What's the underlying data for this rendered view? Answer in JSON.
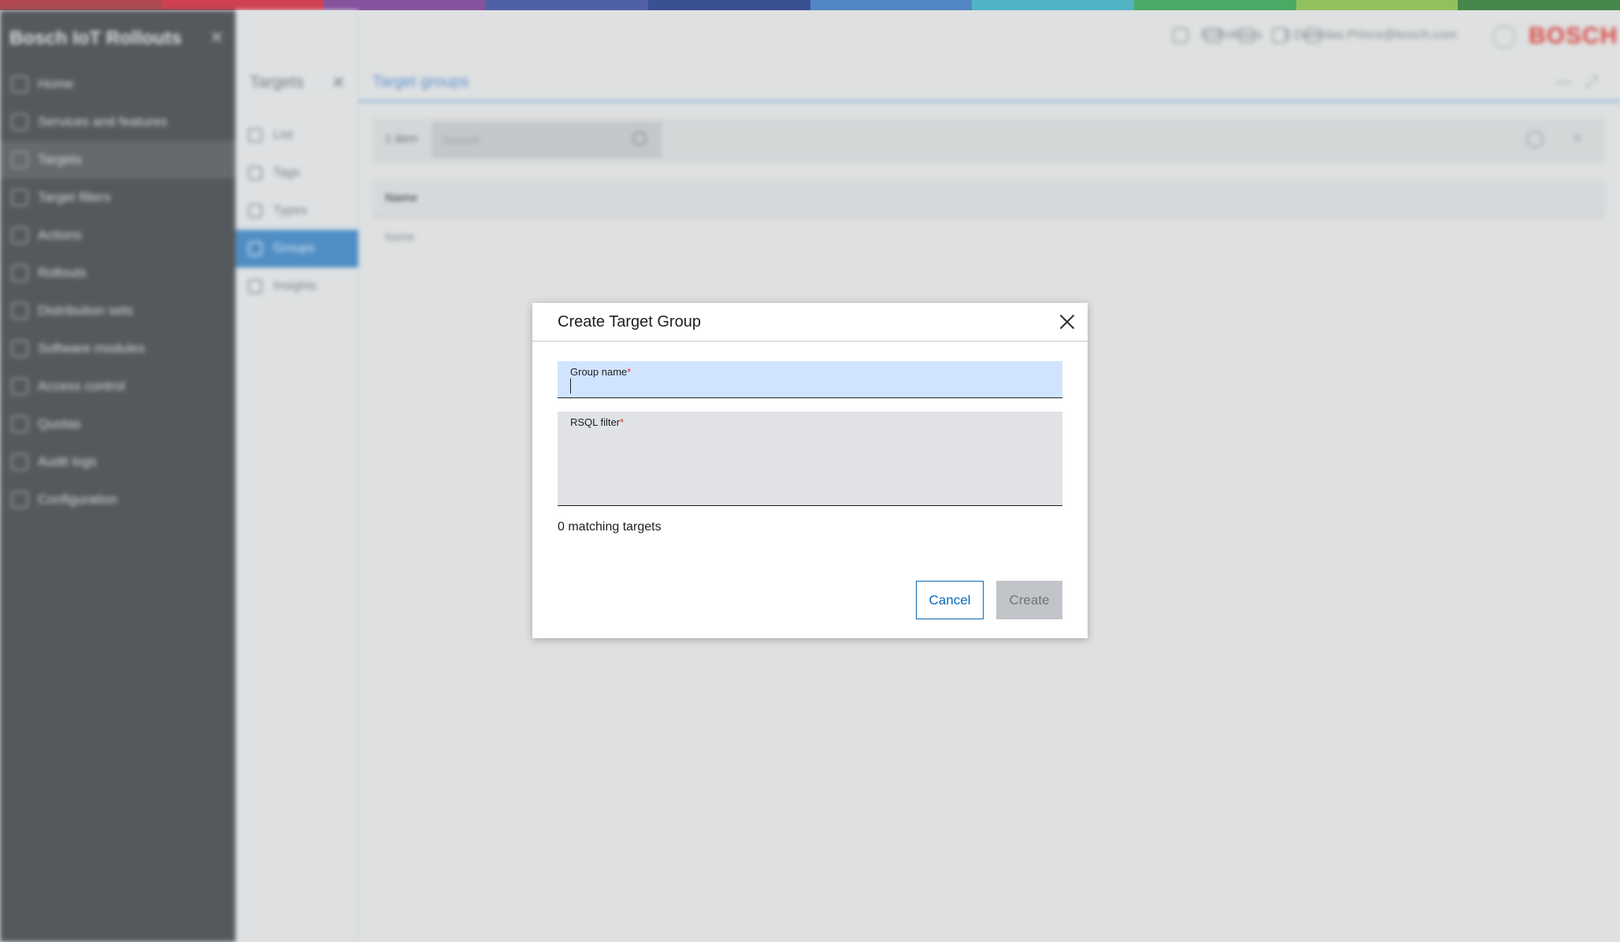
{
  "brand_colors": [
    "#b0303d",
    "#d7263d",
    "#7d3c98",
    "#3a4ea3",
    "#1f3a8a",
    "#3d7cc9",
    "#3db3c9",
    "#34a853",
    "#8bc34a",
    "#2e7d32"
  ],
  "sidebar": {
    "title": "Bosch IoT Rollouts",
    "close_icon": "close-icon",
    "items": [
      {
        "label": "Home",
        "icon": "home-icon"
      },
      {
        "label": "Services and features",
        "icon": "wrench-icon"
      },
      {
        "label": "Targets",
        "icon": "targets-icon"
      },
      {
        "label": "Target filters",
        "icon": "filter-icon"
      },
      {
        "label": "Actions",
        "icon": "actions-icon"
      },
      {
        "label": "Rollouts",
        "icon": "rollouts-icon"
      },
      {
        "label": "Distribution sets",
        "icon": "distribution-icon"
      },
      {
        "label": "Software modules",
        "icon": "modules-icon"
      },
      {
        "label": "Access control",
        "icon": "key-icon"
      },
      {
        "label": "Quotas",
        "icon": "chart-icon"
      },
      {
        "label": "Audit logs",
        "icon": "log-icon"
      },
      {
        "label": "Configuration",
        "icon": "gear-icon"
      }
    ]
  },
  "subpanel": {
    "title": "Targets",
    "items": [
      {
        "label": "List",
        "icon": "list-icon"
      },
      {
        "label": "Tags",
        "icon": "tag-icon"
      },
      {
        "label": "Types",
        "icon": "types-icon"
      },
      {
        "label": "Groups",
        "icon": "groups-icon"
      },
      {
        "label": "Insights",
        "icon": "insights-icon"
      }
    ]
  },
  "header": {
    "tenant": "E1Rollouts",
    "user": "2.Demidas.Prince@bosch.com",
    "logo": "BOSCH"
  },
  "content": {
    "title": "Target groups",
    "item_count": "1 item",
    "search_placeholder": "Search",
    "column_name": "Name",
    "row_value": "home"
  },
  "dialog": {
    "title": "Create Target Group",
    "group_name_label": "Group name",
    "group_name_value": "",
    "rsql_label": "RSQL filter",
    "rsql_value": "",
    "required_mark": "*",
    "matching_text": "0 matching targets",
    "cancel_label": "Cancel",
    "create_label": "Create"
  }
}
